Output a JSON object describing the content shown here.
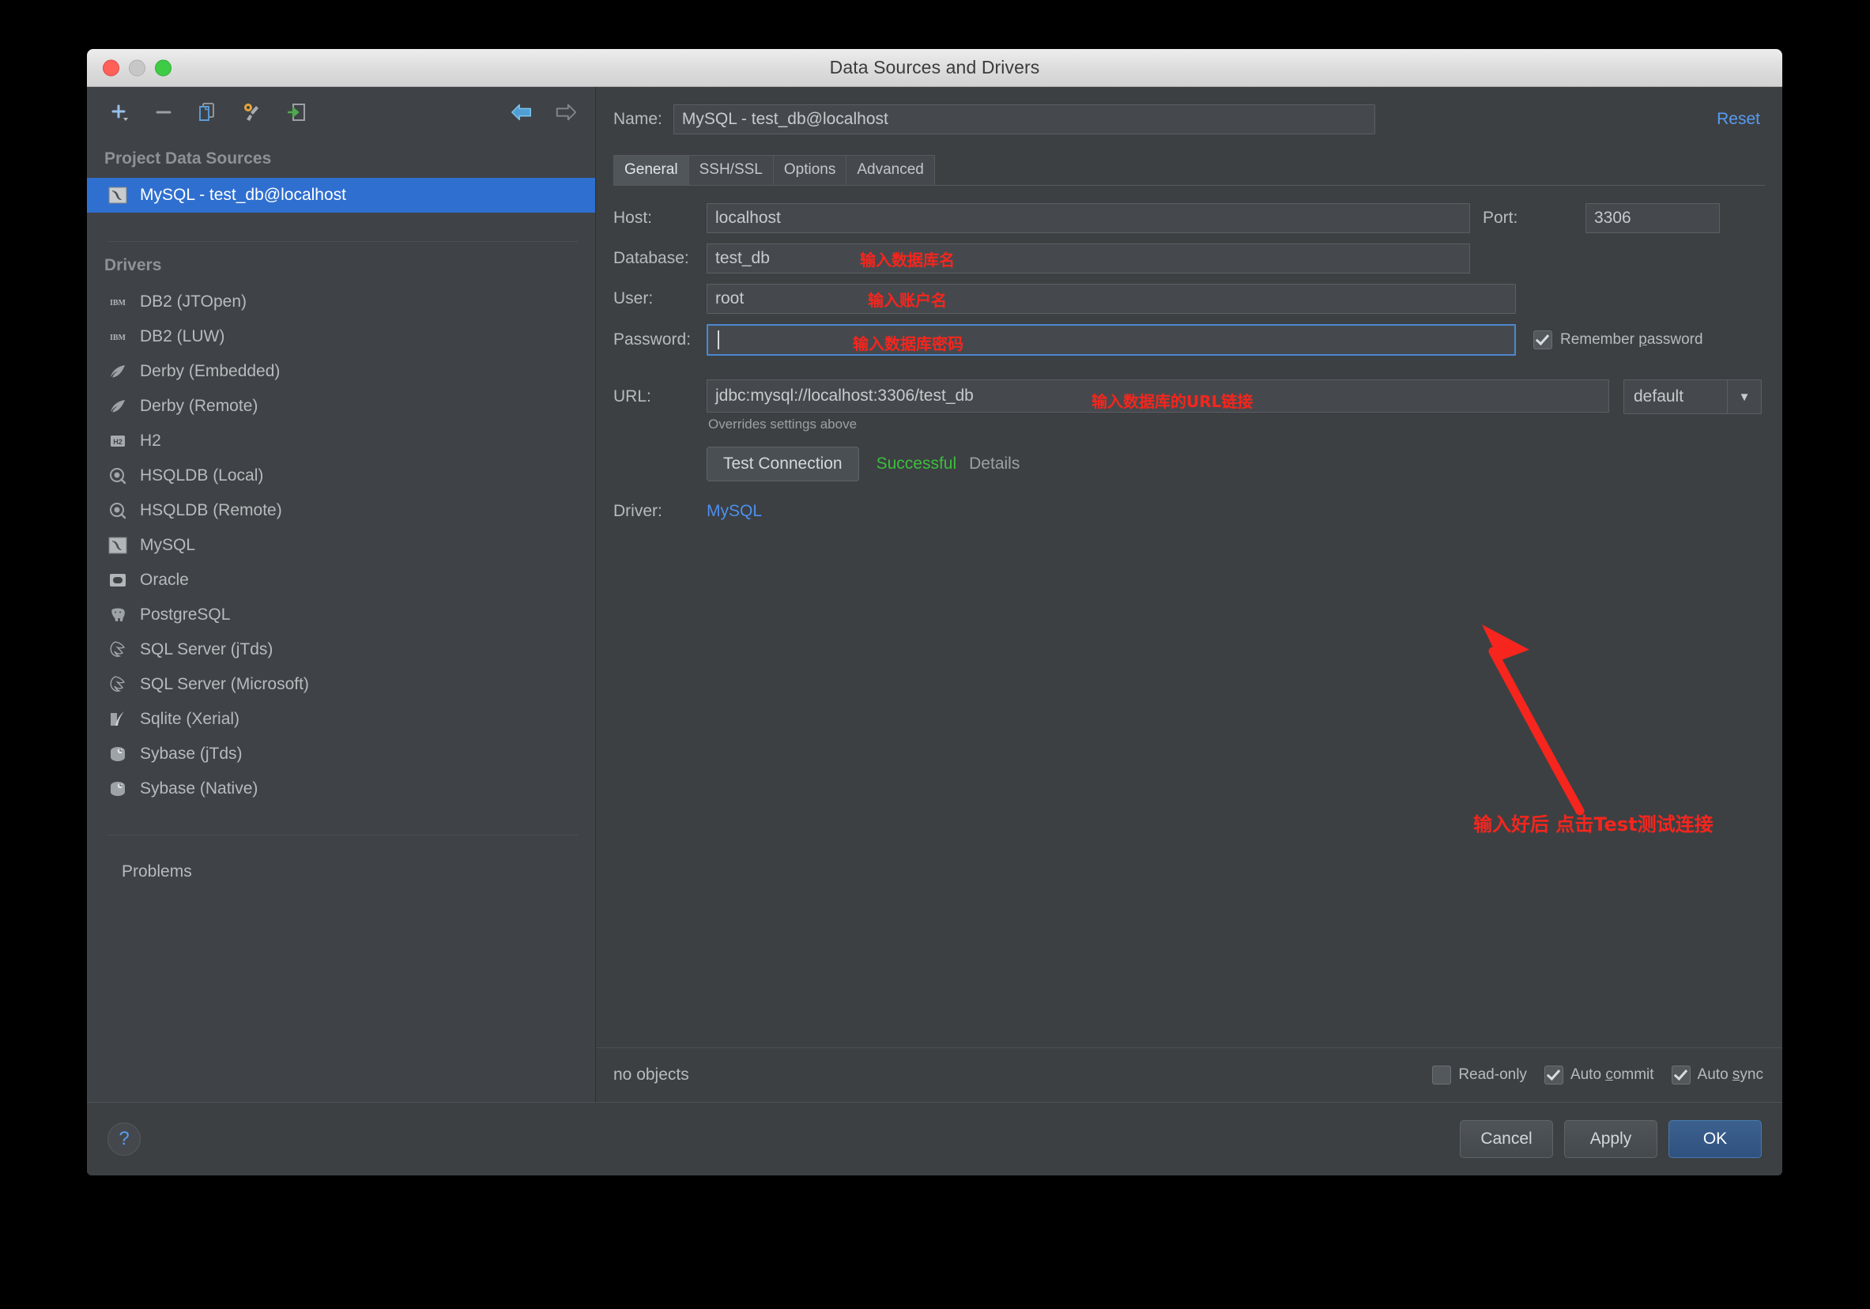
{
  "window": {
    "title": "Data Sources and Drivers"
  },
  "toolbar": {
    "icons": [
      {
        "name": "add-icon",
        "label": "+"
      },
      {
        "name": "remove-icon",
        "label": "−"
      },
      {
        "name": "copy-icon",
        "label": "copy"
      },
      {
        "name": "wrench-icon",
        "label": "wrench"
      },
      {
        "name": "import-icon",
        "label": "import"
      },
      {
        "name": "back-arrow-icon",
        "label": "back"
      },
      {
        "name": "forward-arrow-icon",
        "label": "forward"
      }
    ]
  },
  "sidebar": {
    "project_header": "Project Data Sources",
    "data_sources": [
      {
        "label": "MySQL - test_db@localhost",
        "icon": "mysql-dolphin-icon",
        "selected": true
      }
    ],
    "drivers_header": "Drivers",
    "drivers": [
      {
        "label": "DB2 (JTOpen)",
        "icon": "ibm-icon"
      },
      {
        "label": "DB2 (LUW)",
        "icon": "ibm-icon"
      },
      {
        "label": "Derby (Embedded)",
        "icon": "derby-feather-icon"
      },
      {
        "label": "Derby (Remote)",
        "icon": "derby-feather-icon"
      },
      {
        "label": "H2",
        "icon": "h2-icon"
      },
      {
        "label": "HSQLDB (Local)",
        "icon": "hsqldb-icon"
      },
      {
        "label": "HSQLDB (Remote)",
        "icon": "hsqldb-icon"
      },
      {
        "label": "MySQL",
        "icon": "mysql-dolphin-icon"
      },
      {
        "label": "Oracle",
        "icon": "oracle-icon"
      },
      {
        "label": "PostgreSQL",
        "icon": "postgresql-elephant-icon"
      },
      {
        "label": "SQL Server (jTds)",
        "icon": "sqlserver-icon"
      },
      {
        "label": "SQL Server (Microsoft)",
        "icon": "sqlserver-icon"
      },
      {
        "label": "Sqlite (Xerial)",
        "icon": "sqlite-feather-icon"
      },
      {
        "label": "Sybase (jTds)",
        "icon": "sybase-icon"
      },
      {
        "label": "Sybase (Native)",
        "icon": "sybase-icon"
      }
    ],
    "problems_label": "Problems"
  },
  "main": {
    "name_label": "Name:",
    "name_value": "MySQL - test_db@localhost",
    "reset_label": "Reset",
    "tabs": [
      {
        "label": "General",
        "active": true
      },
      {
        "label": "SSH/SSL",
        "active": false
      },
      {
        "label": "Options",
        "active": false
      },
      {
        "label": "Advanced",
        "active": false
      }
    ],
    "fields": {
      "host_label": "Host:",
      "host_value": "localhost",
      "port_label": "Port:",
      "port_value": "3306",
      "database_label": "Database:",
      "database_value": "test_db",
      "user_label": "User:",
      "user_value": "root",
      "password_label": "Password:",
      "password_value": "",
      "url_label": "URL:",
      "url_value": "jdbc:mysql://localhost:3306/test_db",
      "overrides_note": "Overrides settings above",
      "driver_label": "Driver:",
      "driver_value": "MySQL",
      "schema_combo_value": "default"
    },
    "remember_password": {
      "label_pre": "Remember ",
      "mnemonic": "p",
      "label_post": "assword",
      "checked": true
    },
    "test_connection": {
      "button_label": "Test Connection",
      "status": "Successful",
      "details_label": "Details"
    },
    "annotations": {
      "database": "输入数据库名",
      "user": "输入账户名",
      "password": "输入数据库密码",
      "url": "输入数据库的URL链接",
      "arrow_note": "输入好后  点击Test测试连接",
      "color": "#f6251d"
    },
    "status_strip": {
      "no_objects": "no objects",
      "read_only": {
        "label": "Read-only",
        "checked": false
      },
      "auto_commit": {
        "label_pre": "Auto ",
        "mnemonic": "c",
        "label_post": "ommit",
        "checked": true
      },
      "auto_sync": {
        "label_pre": "Auto ",
        "mnemonic": "s",
        "label_post": "ync",
        "checked": true
      }
    }
  },
  "footer": {
    "help_label": "?",
    "cancel_label": "Cancel",
    "apply_label": "Apply",
    "ok_label": "OK"
  },
  "colors": {
    "selection_blue": "#2f6fd0",
    "link_blue": "#4d8fef",
    "success_green": "#3cbf3c",
    "annotation_red": "#f6251d",
    "panel_bg": "#3c4043",
    "sidebar_bg": "#3f4347"
  }
}
